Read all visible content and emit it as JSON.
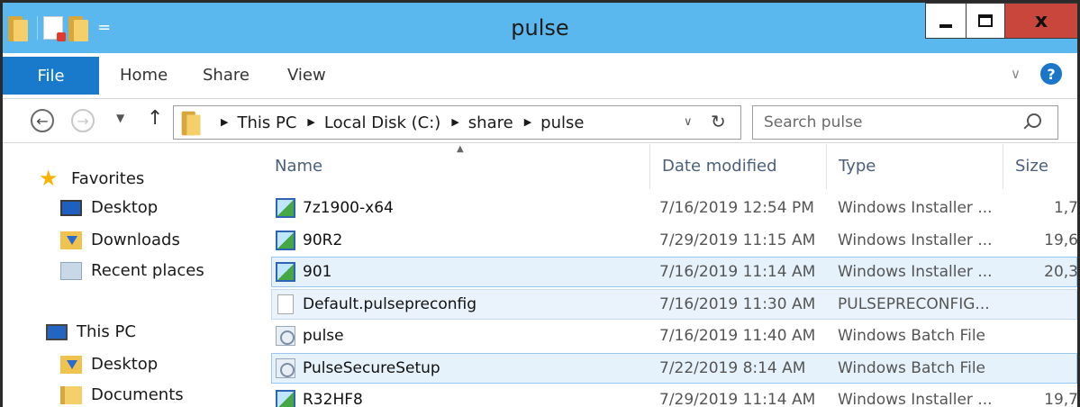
{
  "window": {
    "title": "pulse"
  },
  "title_buttons": {
    "close": "x"
  },
  "ribbon": {
    "file": "File",
    "tabs": [
      "Home",
      "Share",
      "View"
    ],
    "help": "?"
  },
  "address": {
    "crumbs": [
      "This PC",
      "Local Disk (C:)",
      "share",
      "pulse"
    ]
  },
  "search": {
    "placeholder": "Search pulse"
  },
  "nav": {
    "favorites": "Favorites",
    "fav_items": [
      "Desktop",
      "Downloads",
      "Recent places"
    ],
    "this_pc": "This PC",
    "pc_items": [
      "Desktop",
      "Documents"
    ]
  },
  "columns": {
    "name": "Name",
    "date": "Date modified",
    "type": "Type",
    "size": "Size"
  },
  "files": [
    {
      "name": "7z1900-x64",
      "date": "7/16/2019 12:54 PM",
      "type": "Windows Installer ...",
      "size": "1,7",
      "icon": "msi-icon",
      "state": ""
    },
    {
      "name": "90R2",
      "date": "7/29/2019 11:15 AM",
      "type": "Windows Installer ...",
      "size": "19,6",
      "icon": "msi-icon",
      "state": ""
    },
    {
      "name": "901",
      "date": "7/16/2019 11:14 AM",
      "type": "Windows Installer ...",
      "size": "20,3",
      "icon": "msi-icon",
      "state": "selected"
    },
    {
      "name": "Default.pulsepreconfig",
      "date": "7/16/2019 11:30 AM",
      "type": "PULSEPRECONFIG...",
      "size": "",
      "icon": "document-icon",
      "state": "hover"
    },
    {
      "name": "pulse",
      "date": "7/16/2019 11:40 AM",
      "type": "Windows Batch File",
      "size": "",
      "icon": "batch-file-icon",
      "state": ""
    },
    {
      "name": "PulseSecureSetup",
      "date": "7/22/2019 8:14 AM",
      "type": "Windows Batch File",
      "size": "",
      "icon": "batch-file-icon",
      "state": "selected"
    },
    {
      "name": "R32HF8",
      "date": "7/29/2019 11:14 AM",
      "type": "Windows Installer ...",
      "size": "19,7",
      "icon": "msi-icon",
      "state": ""
    }
  ],
  "colors": {
    "titlebar": "#5bb8ee",
    "file_tab": "#1979ca",
    "close_button": "#c9463d",
    "selection": "#e5f1fb"
  }
}
